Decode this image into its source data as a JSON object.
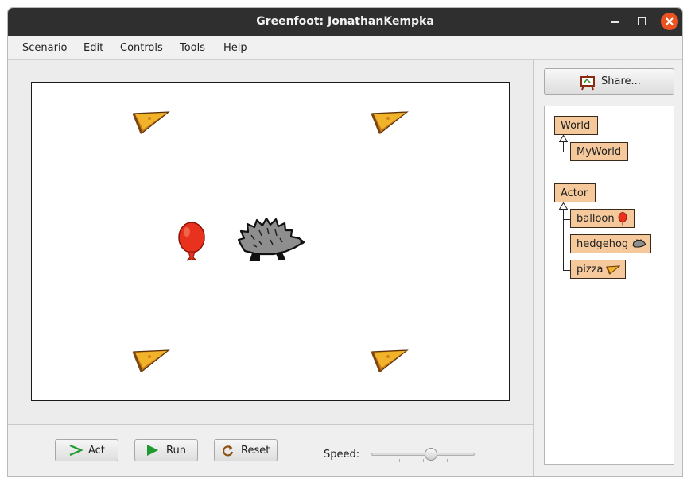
{
  "window": {
    "title": "Greenfoot: JonathanKempka"
  },
  "menu": [
    "Scenario",
    "Edit",
    "Controls",
    "Tools",
    "Help"
  ],
  "controls": {
    "act_label": "Act",
    "run_label": "Run",
    "reset_label": "Reset",
    "speed_label": "Speed:",
    "speed_fraction": 0.59
  },
  "sidebar": {
    "share_label": "Share...",
    "classes": {
      "world": "World",
      "myworld": "MyWorld",
      "actor": "Actor",
      "balloon": "balloon",
      "hedgehog": "hedgehog",
      "pizza": "pizza"
    }
  },
  "colors": {
    "titlebar": "#2f2f2f",
    "close_button": "#e95420",
    "class_fill": "#f5c99b",
    "balloon": "#e8321e",
    "hedgehog": "#8e8e8e",
    "pizza": "#e6a51e",
    "play_icon": "#1f9a2c"
  },
  "icons": {
    "act": "step-arrow-icon",
    "run": "play-icon",
    "reset": "reset-icon",
    "share": "easel-icon",
    "close": "close-icon",
    "minimize": "minimize-icon",
    "maximize": "maximize-icon"
  }
}
